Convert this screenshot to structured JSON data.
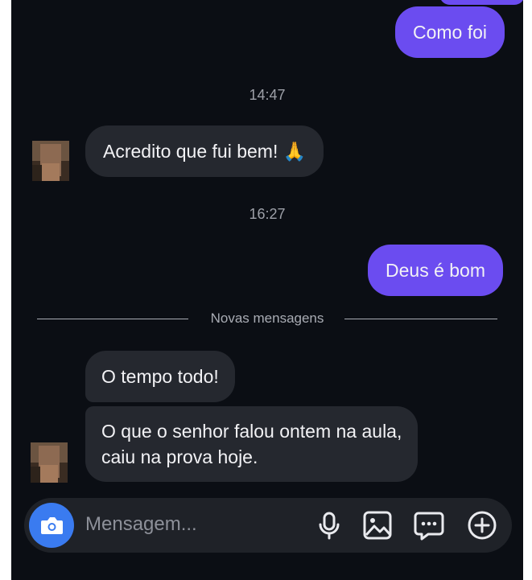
{
  "conversation": {
    "messages": [
      {
        "text": "Como foi"
      },
      {
        "text": "Acredito que fui bem! 🙏"
      },
      {
        "text": "Deus é bom"
      },
      {
        "text": "O tempo todo!"
      },
      {
        "text": "O que o senhor falou ontem na aula,"
      },
      {
        "text": "caiu na prova hoje."
      }
    ],
    "timestamps": [
      "14:47",
      "16:27"
    ],
    "divider_label": "Novas mensagens"
  },
  "composer": {
    "placeholder": "Mensagem..."
  },
  "colors": {
    "background": "#0b0e14",
    "sent_bubble": "#6b4cf0",
    "received_bubble": "#25282f",
    "camera_button": "#3a7bf0"
  },
  "icons": [
    "camera-icon",
    "microphone-icon",
    "gallery-icon",
    "sticker-icon",
    "plus-icon"
  ]
}
